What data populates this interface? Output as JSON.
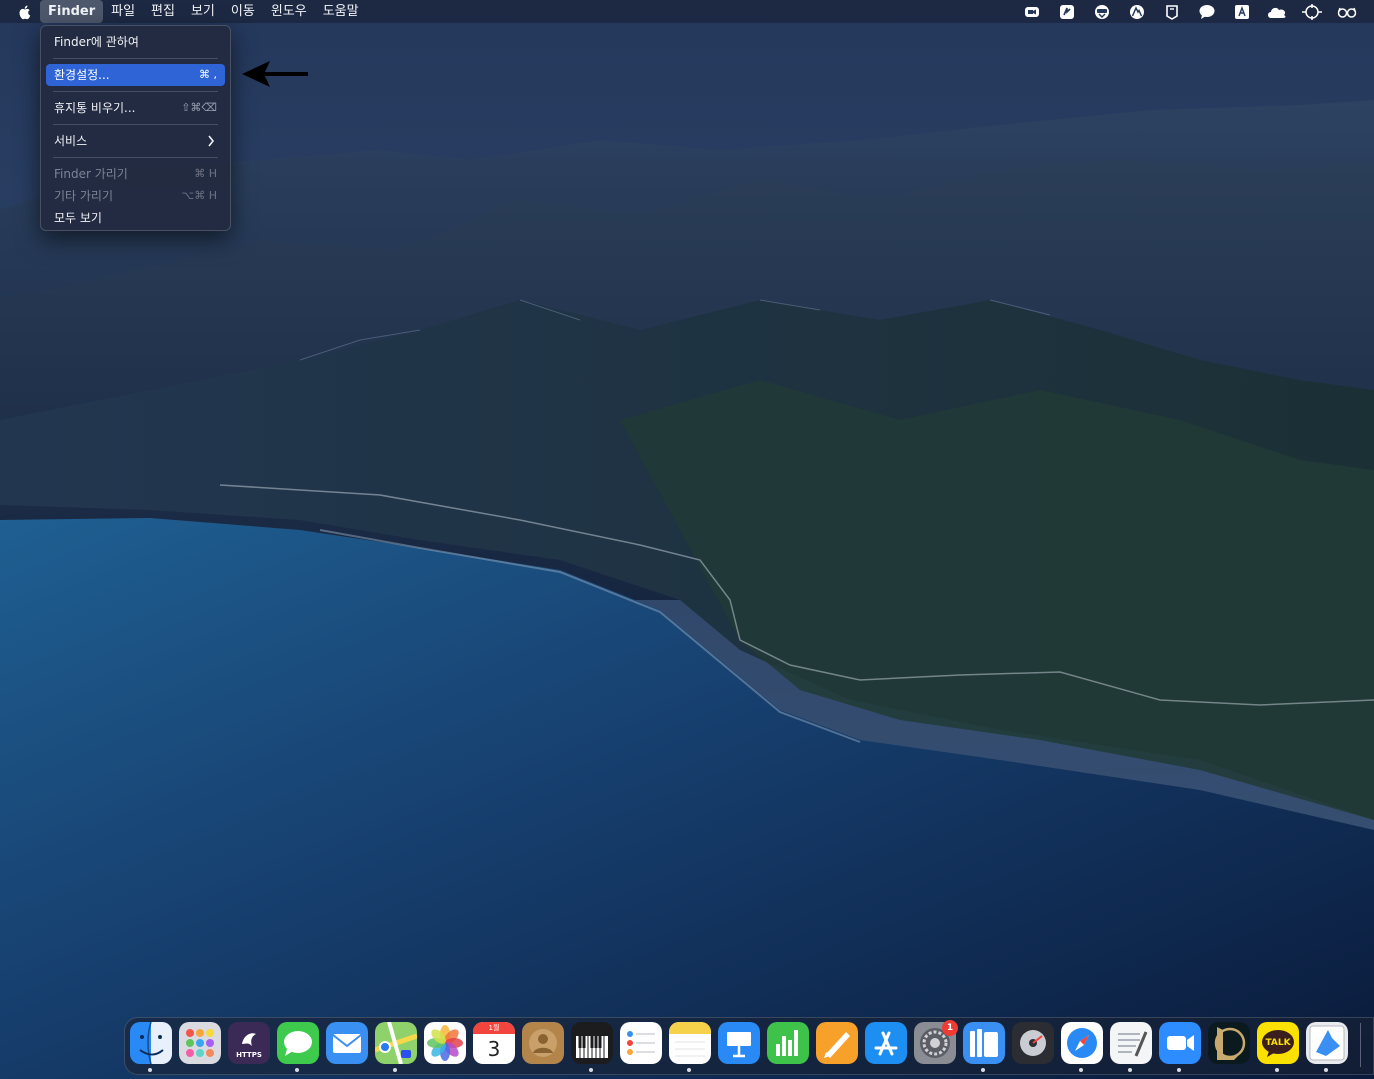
{
  "menubar": {
    "app_name": "Finder",
    "items": [
      "파일",
      "편집",
      "보기",
      "이동",
      "윈도우",
      "도움말"
    ]
  },
  "status_icons": [
    "zoom-status-icon",
    "script-status-icon",
    "bluetooth-headset-icon",
    "nord-icon",
    "clipboard-icon",
    "message-bubble-icon",
    "input-method-icon",
    "cloud-icon",
    "display-icon",
    "glasses-icon"
  ],
  "finder_menu": {
    "about": "Finder에 관하여",
    "preferences": {
      "label": "환경설정...",
      "shortcut": "⌘ ,"
    },
    "empty_trash": {
      "label": "휴지통 비우기...",
      "shortcut": "⇧⌘⌫"
    },
    "services": "서비스",
    "hide_finder": {
      "label": "Finder 가리기",
      "shortcut": "⌘ H"
    },
    "hide_others": {
      "label": "기타 가리기",
      "shortcut": "⌥⌘ H"
    },
    "show_all": "모두 보기"
  },
  "dock": {
    "calendar": {
      "month": "1월",
      "day": "3"
    },
    "https_label": "HTTPS",
    "settings_badge": "1",
    "kakao_label": "TALK"
  },
  "colors": {
    "menu_highlight": "#2f64d6",
    "badge": "#f03b35"
  }
}
